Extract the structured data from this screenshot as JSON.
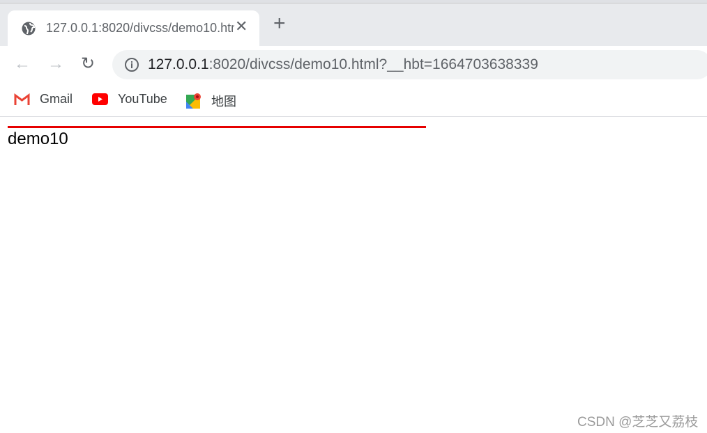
{
  "tab": {
    "title": "127.0.0.1:8020/divcss/demo10.html",
    "close_icon": "close-icon",
    "favicon": "globe-icon"
  },
  "toolbar": {
    "url_host": "127.0.0.1",
    "url_rest": ":8020/divcss/demo10.html?__hbt=1664703638339"
  },
  "bookmarks": [
    {
      "label": "Gmail",
      "icon": "gmail-icon"
    },
    {
      "label": "YouTube",
      "icon": "youtube-icon"
    },
    {
      "label": "地图",
      "icon": "maps-icon"
    }
  ],
  "page": {
    "text": "demo10",
    "rule_color": "#e60000"
  },
  "watermark": "CSDN @芝芝又荔枝"
}
